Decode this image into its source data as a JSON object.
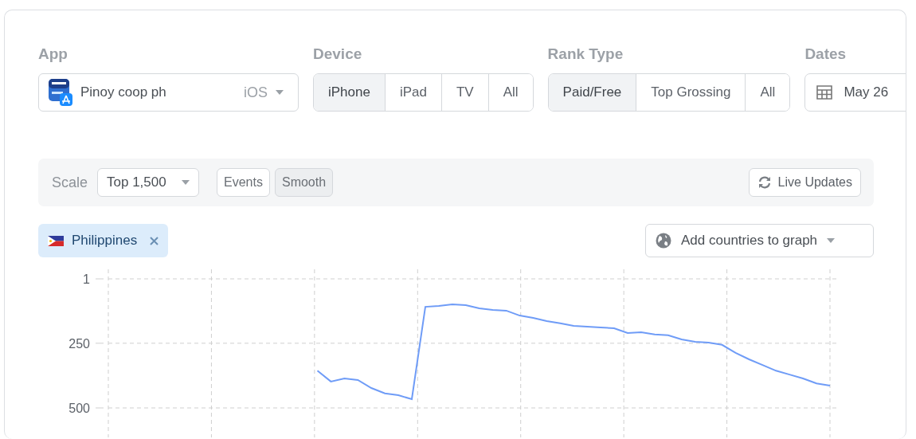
{
  "filters": {
    "app": {
      "label": "App",
      "name": "Pinoy coop ph",
      "platform": "iOS"
    },
    "device": {
      "label": "Device",
      "options": [
        {
          "label": "iPhone",
          "selected": true
        },
        {
          "label": "iPad",
          "selected": false
        },
        {
          "label": "TV",
          "selected": false
        },
        {
          "label": "All",
          "selected": false
        }
      ]
    },
    "rank_type": {
      "label": "Rank Type",
      "options": [
        {
          "label": "Paid/Free",
          "selected": true
        },
        {
          "label": "Top Grossing",
          "selected": false
        },
        {
          "label": "All",
          "selected": false
        }
      ]
    },
    "dates": {
      "label": "Dates",
      "value": "May 26"
    }
  },
  "toolbar": {
    "scale_label": "Scale",
    "scale_value": "Top 1,500",
    "toggles": [
      {
        "label": "Events",
        "selected": false
      },
      {
        "label": "Smooth",
        "selected": true
      }
    ],
    "live_updates": "Live Updates"
  },
  "add_countries": "Add countries to graph",
  "chart": {
    "chart_data": {
      "type": "line",
      "grid": true,
      "ylim": [
        500,
        1
      ],
      "yticks": [
        1,
        250,
        500
      ],
      "categories": [
        null,
        null,
        null,
        null,
        null,
        null,
        null,
        null,
        null,
        null,
        null,
        null,
        null,
        null,
        null,
        null,
        null,
        null,
        null,
        null,
        null,
        null,
        null,
        null,
        null,
        null,
        null,
        null,
        null,
        null,
        null,
        null,
        null,
        null,
        null,
        null,
        null,
        null,
        null
      ],
      "series": [
        {
          "name": "Philippines",
          "color": "#6f9cf7",
          "values": [
            356,
            398,
            386,
            392,
            423,
            444,
            451,
            466,
            109,
            106,
            100,
            103,
            115,
            121,
            124,
            143,
            152,
            164,
            173,
            183,
            186,
            189,
            192,
            210,
            207,
            216,
            219,
            235,
            244,
            247,
            256,
            287,
            312,
            334,
            356,
            371,
            386,
            405,
            414
          ]
        }
      ]
    }
  }
}
